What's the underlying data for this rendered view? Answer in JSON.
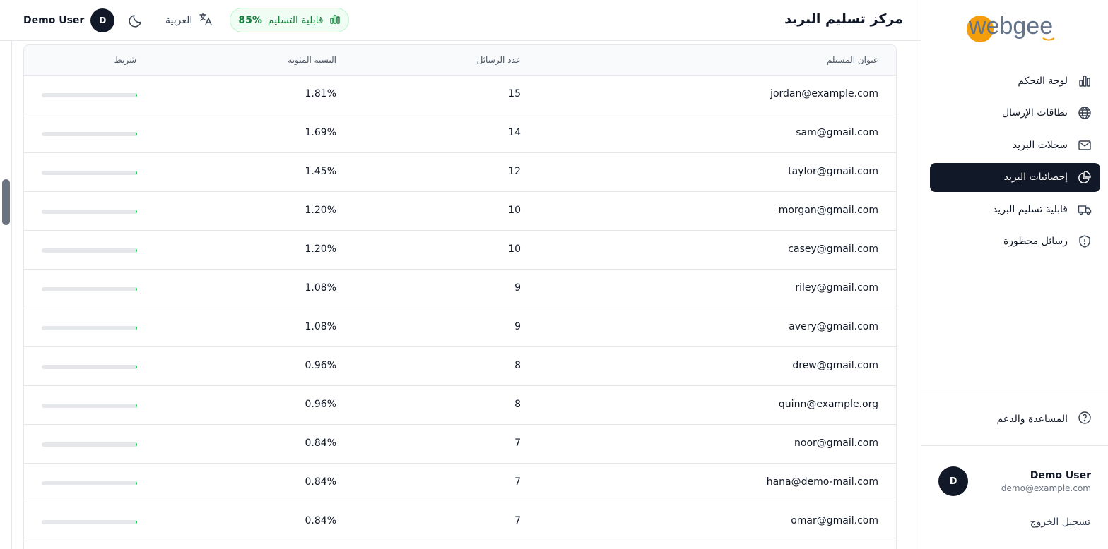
{
  "header": {
    "title": "مركز تسليم البريد",
    "deliverability_label": "قابلية التسليم",
    "deliverability_value": "85%",
    "language": "العربية",
    "user_name": "Demo User",
    "user_initial": "D"
  },
  "sidebar": {
    "logo_text": "webgee",
    "items": [
      {
        "label": "لوحة التحكم",
        "icon": "bar-chart-icon"
      },
      {
        "label": "نطاقات الإرسال",
        "icon": "globe-icon"
      },
      {
        "label": "سجلات البريد",
        "icon": "mail-icon"
      },
      {
        "label": "إحصائيات البريد",
        "icon": "pie-chart-icon",
        "active": true
      },
      {
        "label": "قابلية تسليم البريد",
        "icon": "truck-icon"
      },
      {
        "label": "رسائل محظورة",
        "icon": "shield-icon"
      }
    ],
    "help": "المساعدة والدعم",
    "user": {
      "name": "Demo User",
      "email": "demo@example.com",
      "initial": "D"
    },
    "logout": "تسجيل الخروج"
  },
  "table": {
    "headers": {
      "email": "عنوان المستلم",
      "count": "عدد الرسائل",
      "percent": "النسبة المئوية",
      "bar": "شريط"
    },
    "rows": [
      {
        "email": "jordan@example.com",
        "count": "15",
        "percent": "1.81%",
        "fraction": 0.0181
      },
      {
        "email": "sam@gmail.com",
        "count": "14",
        "percent": "1.69%",
        "fraction": 0.0169
      },
      {
        "email": "taylor@gmail.com",
        "count": "12",
        "percent": "1.45%",
        "fraction": 0.0145
      },
      {
        "email": "morgan@gmail.com",
        "count": "10",
        "percent": "1.20%",
        "fraction": 0.012
      },
      {
        "email": "casey@gmail.com",
        "count": "10",
        "percent": "1.20%",
        "fraction": 0.012
      },
      {
        "email": "riley@gmail.com",
        "count": "9",
        "percent": "1.08%",
        "fraction": 0.0108
      },
      {
        "email": "avery@gmail.com",
        "count": "9",
        "percent": "1.08%",
        "fraction": 0.0108
      },
      {
        "email": "drew@gmail.com",
        "count": "8",
        "percent": "0.96%",
        "fraction": 0.0096
      },
      {
        "email": "quinn@example.org",
        "count": "8",
        "percent": "0.96%",
        "fraction": 0.0096
      },
      {
        "email": "noor@gmail.com",
        "count": "7",
        "percent": "0.84%",
        "fraction": 0.0084
      },
      {
        "email": "hana@demo-mail.com",
        "count": "7",
        "percent": "0.84%",
        "fraction": 0.0084
      },
      {
        "email": "omar@gmail.com",
        "count": "7",
        "percent": "0.84%",
        "fraction": 0.0084
      }
    ]
  },
  "colors": {
    "accent": "#111827",
    "success": "#22c55e",
    "logo_orange": "#f59e0b",
    "logo_gray": "#64748b"
  }
}
